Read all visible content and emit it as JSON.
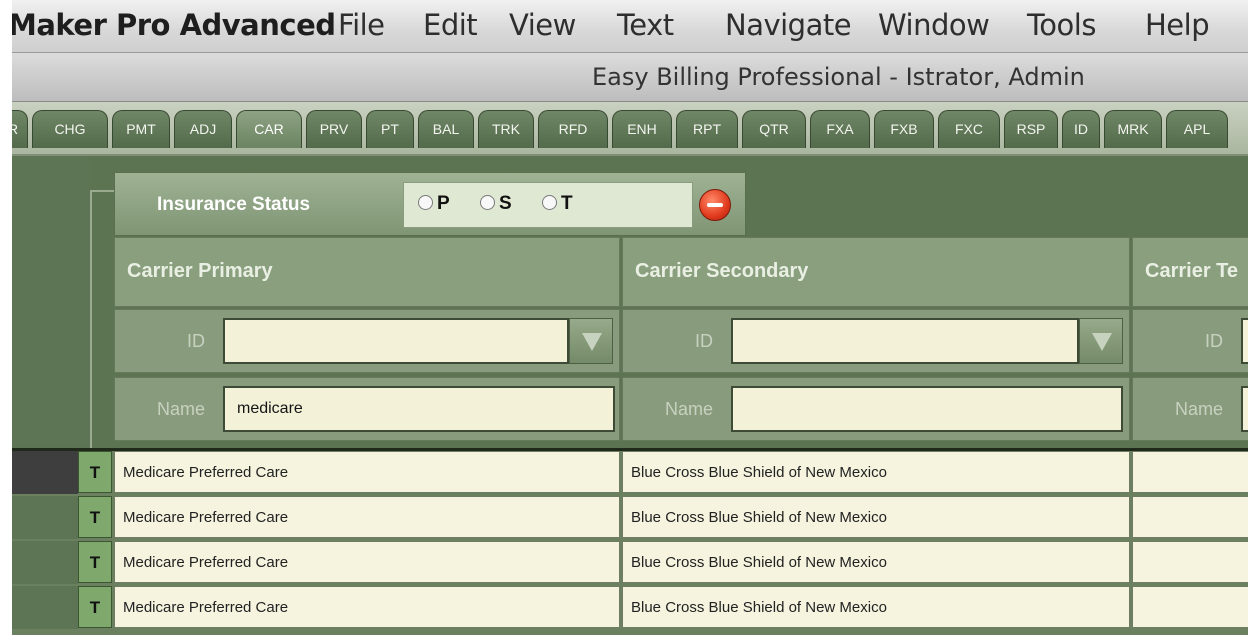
{
  "menubar": {
    "app_name": "Maker Pro Advanced",
    "items": [
      "File",
      "Edit",
      "View",
      "Text",
      "Navigate",
      "Window",
      "Tools",
      "Help"
    ]
  },
  "window": {
    "title": "Easy Billing Professional - Istrator, Admin"
  },
  "tabs": {
    "items": [
      "R",
      "CHG",
      "PMT",
      "ADJ",
      "CAR",
      "PRV",
      "PT",
      "BAL",
      "TRK",
      "RFD",
      "ENH",
      "RPT",
      "QTR",
      "FXA",
      "FXB",
      "FXC",
      "RSP",
      "ID",
      "MRK",
      "APL"
    ],
    "active": "CAR"
  },
  "insurance_status": {
    "label": "Insurance Status",
    "options": [
      "P",
      "S",
      "T"
    ]
  },
  "carriers": {
    "primary": {
      "title": "Carrier Primary",
      "id_label": "ID",
      "id_value": "",
      "name_label": "Name",
      "name_value": "medicare"
    },
    "secondary": {
      "title": "Carrier Secondary",
      "id_label": "ID",
      "id_value": "",
      "name_label": "Name",
      "name_value": ""
    },
    "tertiary": {
      "title": "Carrier Te",
      "id_label": "ID",
      "name_label": "Name"
    }
  },
  "results": [
    {
      "flag": "T",
      "primary": "Medicare Preferred Care",
      "secondary": "Blue Cross Blue Shield of New Mexico",
      "tertiary": ""
    },
    {
      "flag": "T",
      "primary": "Medicare Preferred Care",
      "secondary": "Blue Cross Blue Shield of New Mexico",
      "tertiary": ""
    },
    {
      "flag": "T",
      "primary": "Medicare Preferred Care",
      "secondary": "Blue Cross Blue Shield of New Mexico",
      "tertiary": ""
    },
    {
      "flag": "T",
      "primary": "Medicare Preferred Care",
      "secondary": "Blue Cross Blue Shield of New Mexico",
      "tertiary": ""
    }
  ],
  "colors": {
    "panel_green": "#5d7453",
    "field_cream": "#f4f1d9",
    "flag_green": "#7fa86d",
    "stop_red": "#e03a1c"
  },
  "icons": {
    "clear_status": "stop-icon",
    "dropdown": "triangle-down-icon"
  }
}
